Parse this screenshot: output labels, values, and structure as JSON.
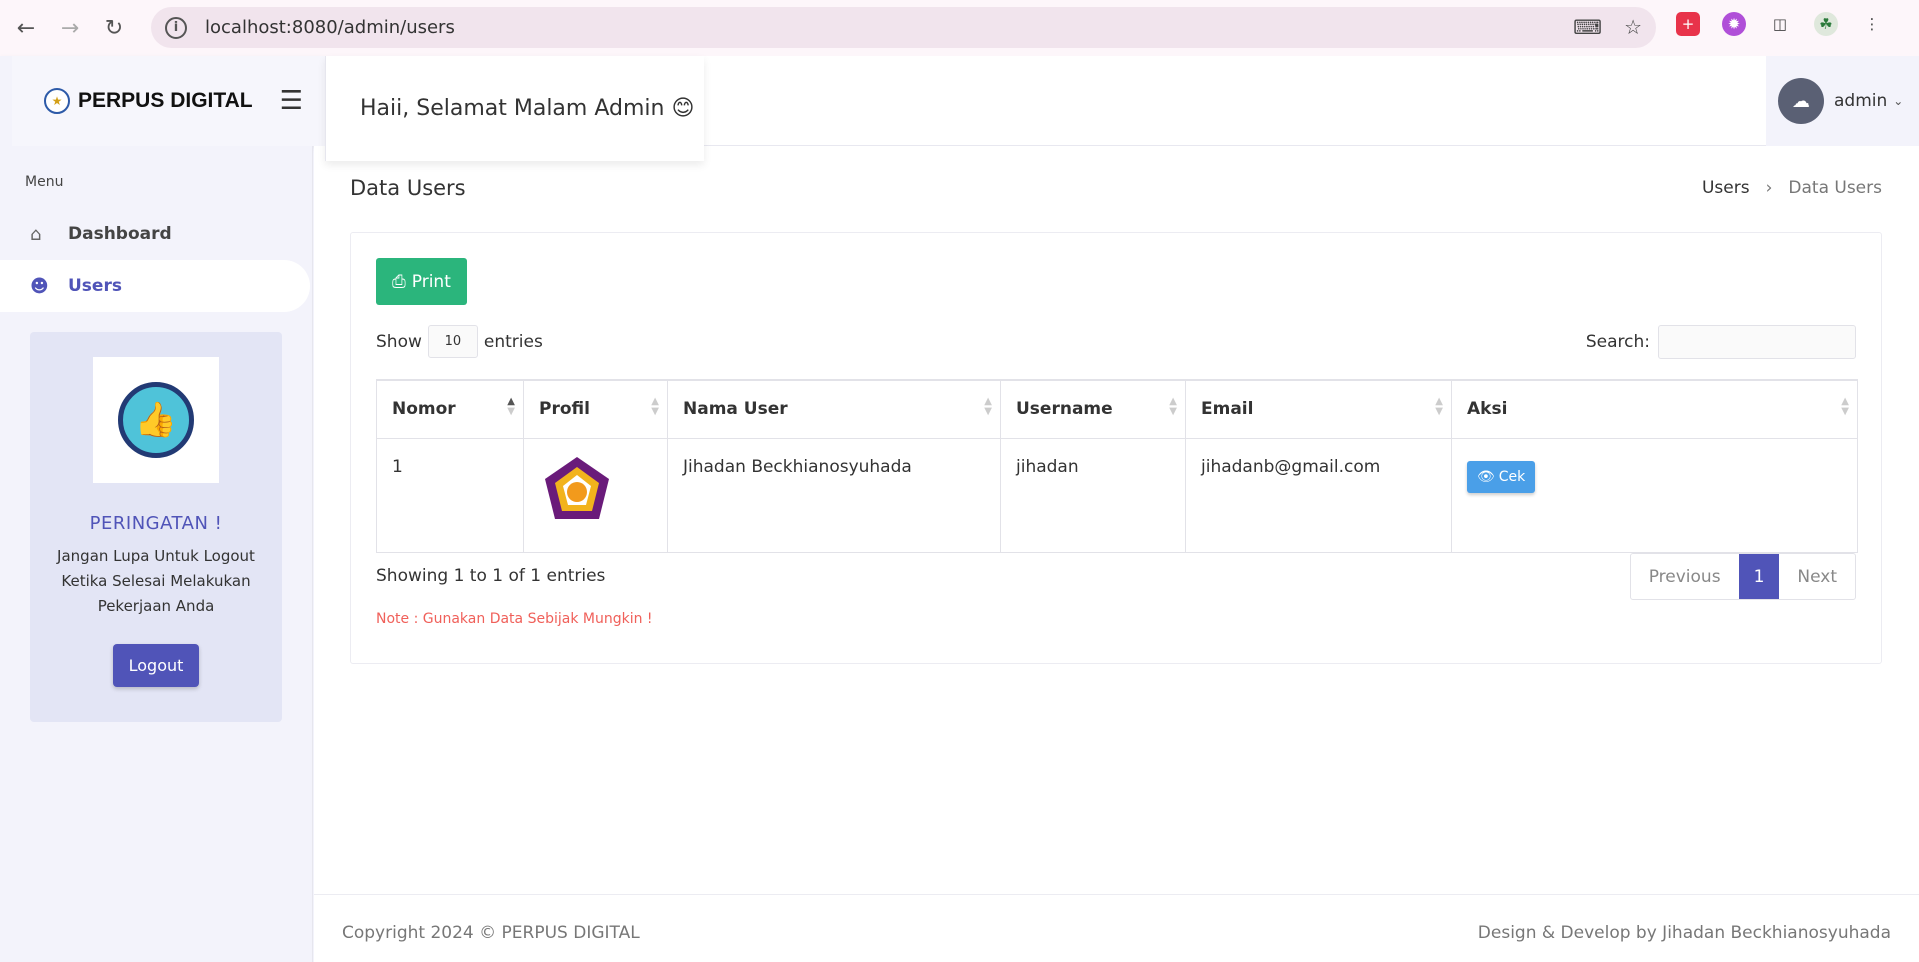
{
  "browser": {
    "url": "localhost:8080/admin/users"
  },
  "header": {
    "brand": "PERPUS DIGITAL",
    "greeting": "Haii, Selamat Malam Admin 😊",
    "user": "admin"
  },
  "sidebar": {
    "menu_label": "Menu",
    "items": [
      {
        "label": "Dashboard",
        "icon": "home-icon"
      },
      {
        "label": "Users",
        "icon": "users-icon"
      }
    ],
    "warning_title": "PERINGATAN !",
    "warning_message": "Jangan Lupa Untuk Logout Ketika Selesai Melakukan Pekerjaan Anda",
    "logout_label": "Logout"
  },
  "main": {
    "title": "Data Users",
    "breadcrumb": [
      "Users",
      "Data Users"
    ],
    "print_label": "Print",
    "show_label": "Show",
    "entries_value": "10",
    "entries_label": "entries",
    "search_label": "Search:",
    "columns": [
      "Nomor",
      "Profil",
      "Nama User",
      "Username",
      "Email",
      "Aksi"
    ],
    "rows": [
      {
        "nomor": "1",
        "nama": "Jihadan Beckhianosyuhada",
        "username": "jihadan",
        "email": "jihadanb@gmail.com",
        "action": "Cek"
      }
    ],
    "showing_text": "Showing 1 to 1 of 1 entries",
    "pagination": {
      "previous": "Previous",
      "current": "1",
      "next": "Next"
    },
    "note": "Note : Gunakan Data Sebijak Mungkin !"
  },
  "footer": {
    "copyright": "Copyright 2024 © PERPUS DIGITAL",
    "credit": "Design & Develop by Jihadan Beckhianosyuhada"
  },
  "colors": {
    "accent": "#5054b8",
    "print_button": "#2bb57c",
    "cek_button": "#4a9fe8",
    "note": "#f0605a"
  }
}
